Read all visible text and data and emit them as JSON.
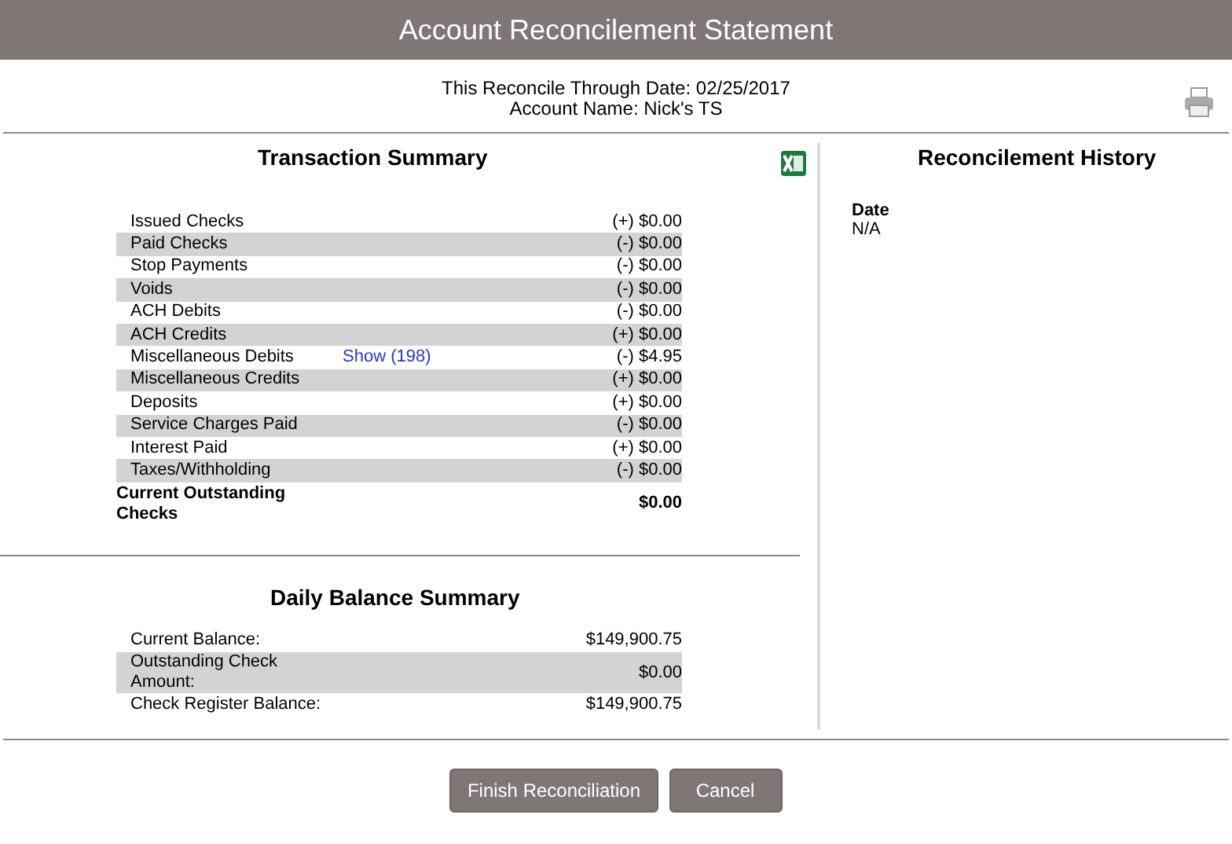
{
  "window": {
    "title": "Account Reconcilement Statement"
  },
  "info": [
    "This Reconcile Through Date: 02/25/2017",
    "Account Name: Nick's TS"
  ],
  "transaction_summary": {
    "title": "Transaction Summary",
    "rows": [
      {
        "kind": "item",
        "label": "Issued Checks",
        "amount": "(+) $0.00"
      },
      {
        "kind": "item",
        "label": "Paid Checks",
        "amount": "(-) $0.00"
      },
      {
        "kind": "item",
        "label": "Stop Payments",
        "amount": "(-) $0.00"
      },
      {
        "kind": "item",
        "label": "Voids",
        "amount": "(-) $0.00"
      },
      {
        "kind": "item",
        "label": "ACH Debits",
        "amount": "(-) $0.00"
      },
      {
        "kind": "item",
        "label": "ACH Credits",
        "amount": "(+) $0.00"
      },
      {
        "kind": "item",
        "label": "Miscellaneous Debits",
        "link": "Show (198)",
        "amount": "(-) $4.95"
      },
      {
        "kind": "item",
        "label": "Miscellaneous Credits",
        "amount": "(+) $0.00"
      },
      {
        "kind": "item",
        "label": "Deposits",
        "amount": "(+) $0.00"
      },
      {
        "kind": "item",
        "label": "Service Charges Paid",
        "amount": "(-) $0.00"
      },
      {
        "kind": "item",
        "label": "Interest Paid",
        "amount": "(+) $0.00"
      },
      {
        "kind": "item",
        "label": "Taxes/Withholding",
        "amount": "(-) $0.00"
      },
      {
        "kind": "total",
        "label": "Current Outstanding Checks",
        "amount": "$0.00"
      }
    ]
  },
  "daily_balance_summary": {
    "title": "Daily Balance Summary",
    "rows": [
      {
        "label": "Current Balance:",
        "amount": "$149,900.75"
      },
      {
        "label": "Outstanding Check Amount:",
        "amount": "$0.00"
      },
      {
        "label": "Check Register Balance:",
        "amount": "$149,900.75"
      }
    ]
  },
  "reconcilement_history": {
    "title": "Reconcilement History",
    "column": "Date",
    "rows": [
      "N/A"
    ]
  },
  "buttons": [
    "Finish Reconciliation",
    "Cancel"
  ]
}
